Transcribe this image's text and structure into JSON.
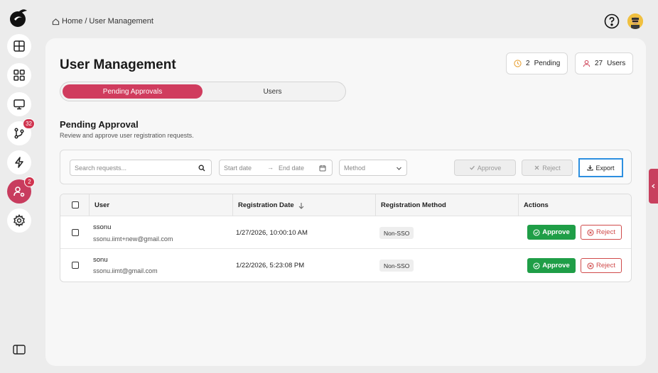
{
  "breadcrumb": {
    "home": "Home",
    "separator": "/",
    "current": "User Management"
  },
  "sidebar": {
    "items": [
      {
        "name": "dashboard",
        "icon": "layout-icon",
        "badge": ""
      },
      {
        "name": "apps",
        "icon": "grid-icon",
        "badge": ""
      },
      {
        "name": "monitor",
        "icon": "monitor-icon",
        "badge": ""
      },
      {
        "name": "workflows",
        "icon": "branch-icon",
        "badge": "32"
      },
      {
        "name": "automation",
        "icon": "bolt-icon",
        "badge": ""
      },
      {
        "name": "users",
        "icon": "user-settings-icon",
        "badge": "2"
      },
      {
        "name": "settings",
        "icon": "gear-icon",
        "badge": ""
      }
    ]
  },
  "page": {
    "title": "User Management",
    "stats": {
      "pending_count": "2",
      "pending_label": "Pending",
      "users_count": "27",
      "users_label": "Users"
    },
    "tabs": [
      {
        "label": "Pending Approvals",
        "active": true
      },
      {
        "label": "Users",
        "active": false
      }
    ],
    "section_title": "Pending Approval",
    "section_subtitle": "Review and approve user registration requests."
  },
  "filters": {
    "search_placeholder": "Search requests...",
    "start_date": "Start date",
    "end_date": "End date",
    "method_placeholder": "Method",
    "approve_label": "Approve",
    "reject_label": "Reject",
    "export_label": "Export"
  },
  "table": {
    "columns": [
      "User",
      "Registration Date",
      "Registration Method",
      "Actions"
    ],
    "rows": [
      {
        "name": "ssonu",
        "email": "ssonu.iimt+new@gmail.com",
        "date": "1/27/2026, 10:00:10 AM",
        "method": "Non-SSO",
        "approve": "Approve",
        "reject": "Reject"
      },
      {
        "name": "sonu",
        "email": "ssonu.iimt@gmail.com",
        "date": "1/22/2026, 5:23:08 PM",
        "method": "Non-SSO",
        "approve": "Approve",
        "reject": "Reject"
      }
    ]
  },
  "colors": {
    "accent": "#d03c5e",
    "approve": "#1f9e47",
    "reject": "#d04a4a",
    "focus": "#2d8fe0"
  }
}
